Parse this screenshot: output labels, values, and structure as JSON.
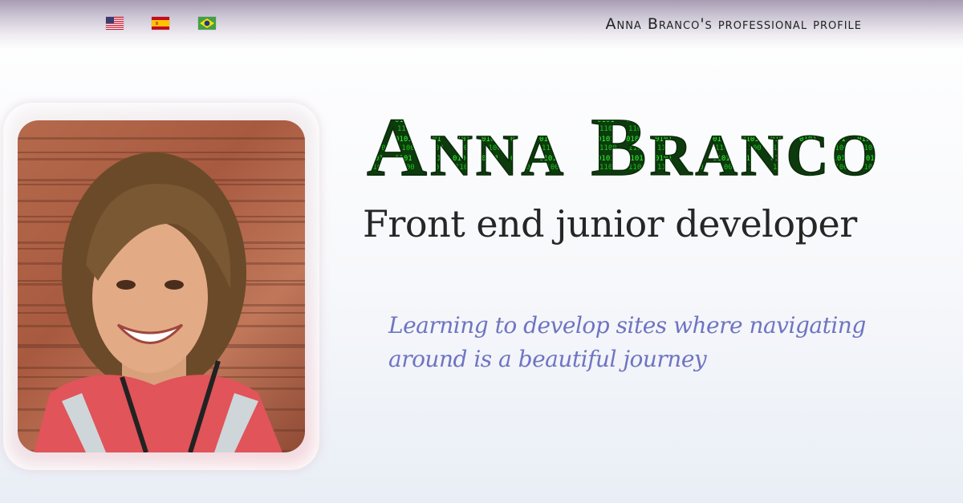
{
  "header": {
    "languages": [
      {
        "code": "en",
        "icon": "us-flag-icon"
      },
      {
        "code": "es",
        "icon": "spain-flag-icon"
      },
      {
        "code": "pt",
        "icon": "brazil-flag-icon"
      }
    ],
    "profile_link": "Anna Branco's professional profile"
  },
  "hero": {
    "name": "Anna Branco",
    "role": "Front end junior developer",
    "tagline": "Learning to develop sites where navigating around is a beautiful journey"
  },
  "colors": {
    "name_fill": "#1faa1f",
    "tagline": "#6f74c2",
    "role": "#262626"
  }
}
